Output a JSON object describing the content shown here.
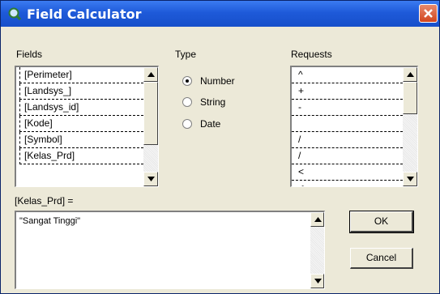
{
  "window": {
    "title": "Field Calculator"
  },
  "fields": {
    "label": "Fields",
    "items": [
      "[Perimeter]",
      "[Landsys_]",
      "[Landsys_id]",
      "[Kode]",
      "[Symbol]",
      "[Kelas_Prd]"
    ]
  },
  "type": {
    "label": "Type",
    "options": [
      "Number",
      "String",
      "Date"
    ],
    "selected": "Number"
  },
  "requests": {
    "label": "Requests",
    "items": [
      "^",
      "+",
      "-",
      "",
      "/",
      "/",
      "<",
      "<="
    ]
  },
  "expression": {
    "label": "[Kelas_Prd] =",
    "value": "\"Sangat Tinggi\""
  },
  "buttons": {
    "ok": "OK",
    "cancel": "Cancel"
  }
}
